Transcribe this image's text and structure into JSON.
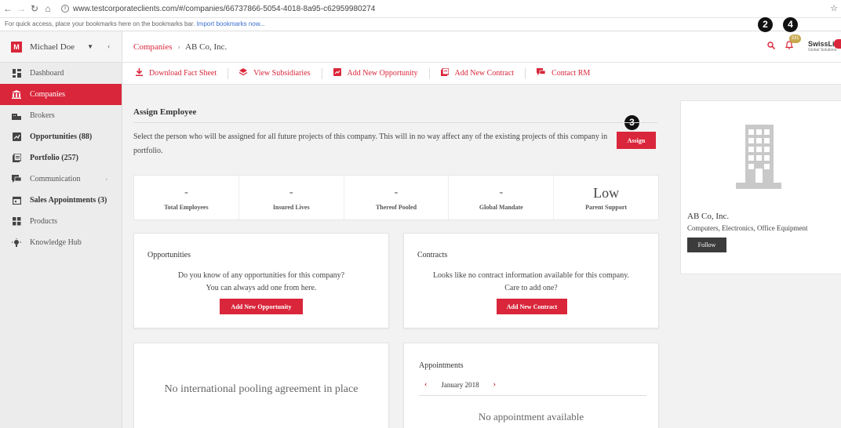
{
  "browser": {
    "url": "www.testcorporateclients.com/#/companies/66737866-5054-4018-8a95-c62959980274",
    "bookmarks_text": "For quick access, place your bookmarks here on the bookmarks bar.",
    "bookmarks_link": "Import bookmarks now..."
  },
  "user": {
    "initial": "M",
    "name": "Michael Doe"
  },
  "sidebar": {
    "items": [
      {
        "label": "Dashboard",
        "icon": "dashboard-icon"
      },
      {
        "label": "Companies",
        "icon": "bank-icon"
      },
      {
        "label": "Brokers",
        "icon": "brokers-icon"
      },
      {
        "label": "Opportunities (88)",
        "icon": "opportunities-icon"
      },
      {
        "label": "Portfolio (257)",
        "icon": "portfolio-icon"
      },
      {
        "label": "Communication",
        "icon": "chat-icon"
      },
      {
        "label": "Sales Appointments (3)",
        "icon": "calendar-icon"
      },
      {
        "label": "Products",
        "icon": "products-icon"
      },
      {
        "label": "Knowledge Hub",
        "icon": "bulb-icon"
      }
    ]
  },
  "header": {
    "breadcrumb_root": "Companies",
    "breadcrumb_current": "AB Co, Inc.",
    "notification_count": "331",
    "brand_name": "SwissLife",
    "brand_sub": "Global Solutions"
  },
  "actions": {
    "fact_sheet": "Download Fact Sheet",
    "subsidiaries": "View Subsidiaries",
    "new_opportunity": "Add New Opportunity",
    "new_contract": "Add New Contract",
    "contact_rm": "Contact RM"
  },
  "assign": {
    "title": "Assign Employee",
    "description": "Select the person who will be assigned for all future projects of this company. This will in no way affect any of the existing projects of this company in portfolio.",
    "button": "Assign"
  },
  "callouts": {
    "c2": "2",
    "c3": "3",
    "c4": "4"
  },
  "stats": {
    "total_employees": {
      "value": "-",
      "label": "Total Employees"
    },
    "insured_lives": {
      "value": "-",
      "label": "Insured Lives"
    },
    "thereof_pooled": {
      "value": "-",
      "label": "Thereof Pooled"
    },
    "global_mandate": {
      "value": "-",
      "label": "Global Mandate"
    },
    "parent_support": {
      "value": "Low",
      "label": "Parent Support"
    }
  },
  "opportunities_card": {
    "title": "Opportunities",
    "line1": "Do you know of any opportunities for this company?",
    "line2": "You can always add one from here.",
    "button": "Add New Opportunity"
  },
  "contracts_card": {
    "title": "Contracts",
    "line1": "Looks like no contract information available for this company.",
    "line2": "Care to add one?",
    "button": "Add New Contract"
  },
  "pooling_card": {
    "text": "No international pooling agreement in place"
  },
  "appointments_card": {
    "title": "Appointments",
    "month": "January 2018",
    "empty": "No appointment available"
  },
  "company": {
    "name": "AB Co, Inc.",
    "industry": "Computers, Electronics, Office Equipment",
    "follow": "Follow"
  },
  "colors": {
    "accent": "#d9263a",
    "sidebar_bg": "#ececec",
    "follow_btn": "#3c3c3c"
  }
}
